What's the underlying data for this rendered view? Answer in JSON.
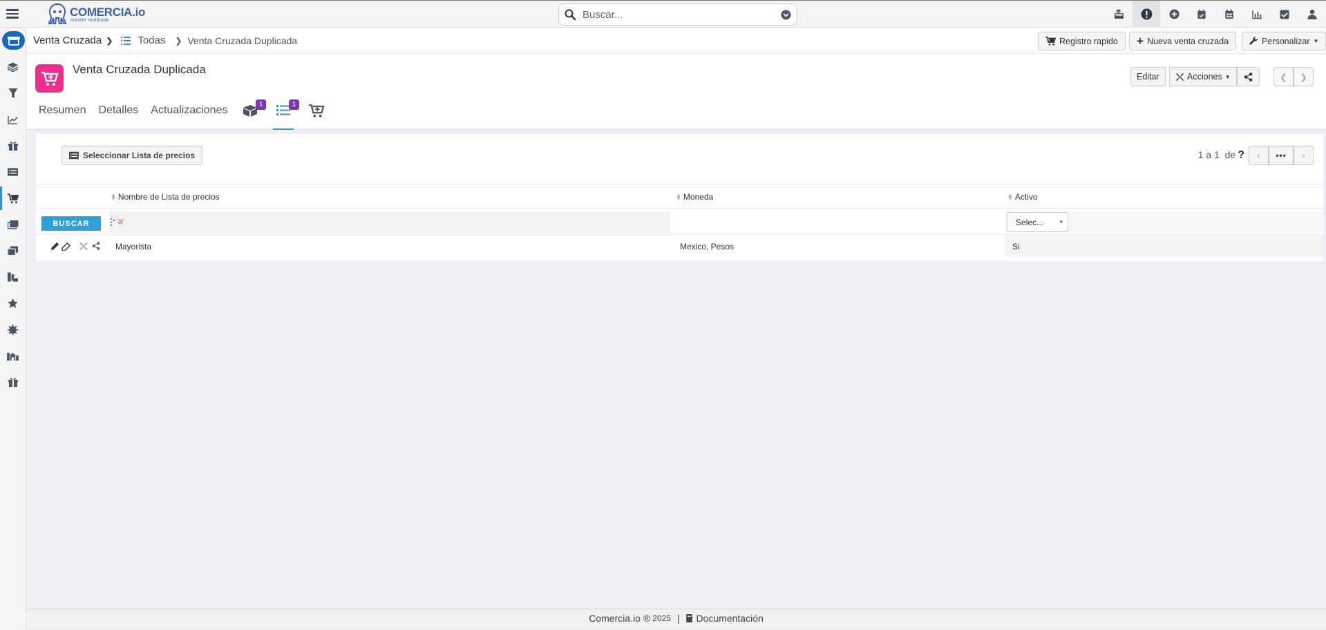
{
  "app": {
    "logo_main": "COMERCIA.io",
    "logo_sub": "master multitask"
  },
  "search": {
    "placeholder": "Buscar..."
  },
  "breadcrumb": {
    "module": "Venta Cruzada",
    "list": "Todas",
    "current": "Venta Cruzada Duplicada"
  },
  "actions": {
    "quick": "Registro rapido",
    "new": "Nueva venta cruzada",
    "customize": "Personalizar"
  },
  "record": {
    "title": "Venta Cruzada Duplicada",
    "edit": "Editar",
    "actions": "Acciones"
  },
  "tabs": [
    {
      "label": "Resumen"
    },
    {
      "label": "Detalles"
    },
    {
      "label": "Actualizaciones"
    }
  ],
  "tab_badges": {
    "products": "1",
    "pricelists": "1"
  },
  "subpanel": {
    "select_button": "Seleccionar Lista de precios",
    "pagination": "1 a 1  de",
    "pagination_help": "?",
    "more": "•••",
    "columns": [
      "Nombre de Lista de precios",
      "Moneda",
      "Activo"
    ],
    "filter": {
      "button": "BUSCAR",
      "name_mark": "'a'",
      "active_select": "Selec..."
    },
    "rows": [
      {
        "name": "Mayorista",
        "currency": "Mexico, Pesos",
        "active": "Si"
      }
    ]
  },
  "footer": {
    "brand": "Comercia.io ®",
    "year": "2025",
    "separator": "|",
    "docs": "Documentación"
  },
  "colors": {
    "accent": "#2fa0d8",
    "brand": "#3f5ea8",
    "record_icon": "#ee2e8e",
    "badge": "#7c3aa9"
  }
}
